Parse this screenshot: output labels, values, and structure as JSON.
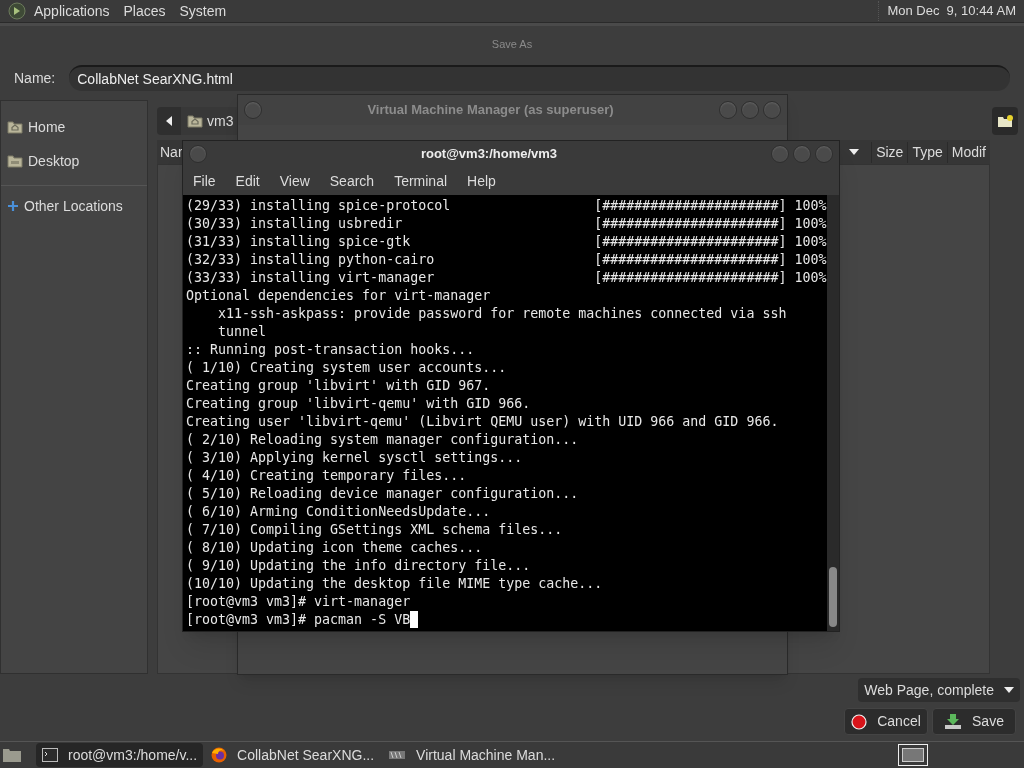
{
  "top_panel": {
    "menus": [
      "Applications",
      "Places",
      "System"
    ],
    "clock": "Mon Dec  9, 10:44 AM"
  },
  "save_dialog": {
    "title": "Save As",
    "name_label": "Name:",
    "name_value": "CollabNet SearXNG.html",
    "sidebar": [
      {
        "label": "Home",
        "kind": "home"
      },
      {
        "label": "Desktop",
        "kind": "folder"
      },
      {
        "label": "Other Locations",
        "kind": "add"
      }
    ],
    "path": [
      "vm3"
    ],
    "columns": [
      "Nar",
      "Size",
      "Type",
      "Modif"
    ],
    "file_type": "Web Page, complete",
    "buttons": [
      {
        "label": "Cancel",
        "kind": "cancel"
      },
      {
        "label": "Save",
        "kind": "save"
      }
    ]
  },
  "vmm_window": {
    "title": "Virtual Machine Manager (as superuser)"
  },
  "terminal": {
    "title": "root@vm3:/home/vm3",
    "menus": [
      "File",
      "Edit",
      "View",
      "Search",
      "Terminal",
      "Help"
    ],
    "lines": [
      "(29/33) installing spice-protocol                  [######################] 100%",
      "(30/33) installing usbredir                        [######################] 100%",
      "(31/33) installing spice-gtk                       [######################] 100%",
      "(32/33) installing python-cairo                    [######################] 100%",
      "(33/33) installing virt-manager                    [######################] 100%",
      "Optional dependencies for virt-manager",
      "    x11-ssh-askpass: provide password for remote machines connected via ssh",
      "    tunnel",
      ":: Running post-transaction hooks...",
      "( 1/10) Creating system user accounts...",
      "Creating group 'libvirt' with GID 967.",
      "Creating group 'libvirt-qemu' with GID 966.",
      "Creating user 'libvirt-qemu' (Libvirt QEMU user) with UID 966 and GID 966.",
      "( 2/10) Reloading system manager configuration...",
      "( 3/10) Applying kernel sysctl settings...",
      "( 4/10) Creating temporary files...",
      "( 5/10) Reloading device manager configuration...",
      "( 6/10) Arming ConditionNeedsUpdate...",
      "( 7/10) Compiling GSettings XML schema files...",
      "( 8/10) Updating icon theme caches...",
      "( 9/10) Updating the info directory file...",
      "(10/10) Updating the desktop file MIME type cache...",
      "[root@vm3 vm3]# virt-manager",
      "[root@vm3 vm3]# pacman -S VB"
    ]
  },
  "taskbar": {
    "tasks": [
      {
        "label": "root@vm3:/home/v...",
        "kind": "terminal",
        "selected": true
      },
      {
        "label": "CollabNet SearXNG...",
        "kind": "browser",
        "selected": false
      },
      {
        "label": "Virtual Machine Man...",
        "kind": "vmm",
        "selected": false
      }
    ]
  }
}
